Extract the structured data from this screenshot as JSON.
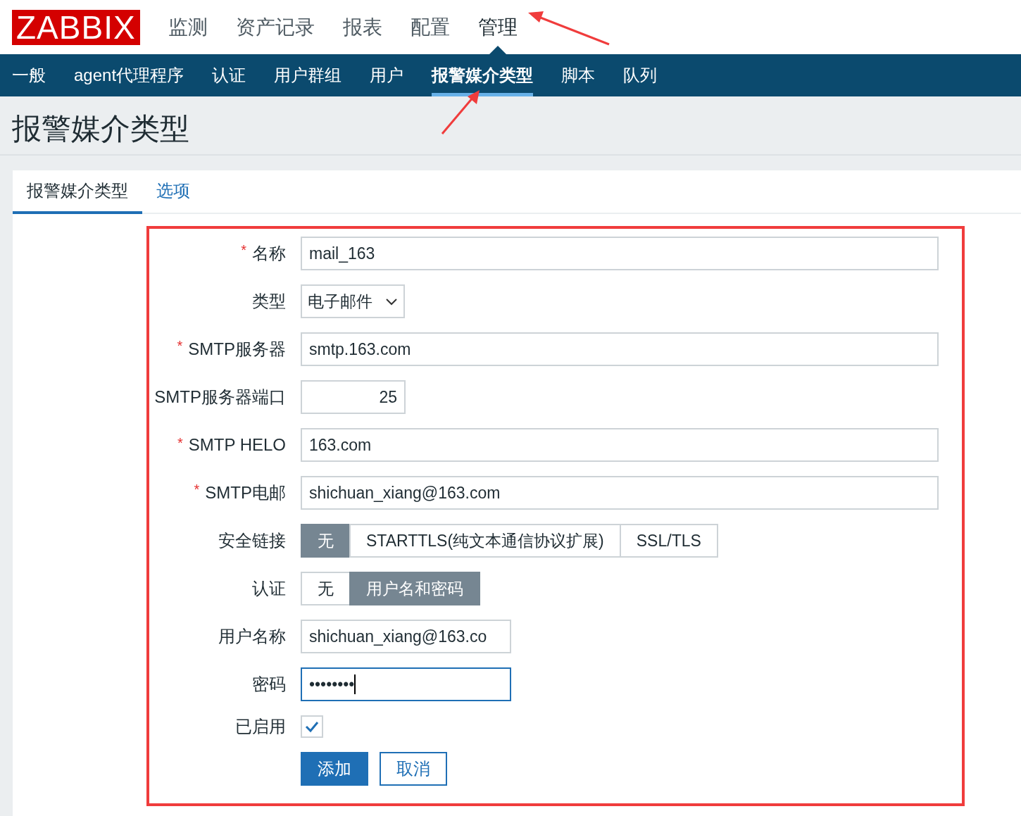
{
  "logo": "ZABBIX",
  "main_menu": [
    {
      "label": "监测",
      "selected": false
    },
    {
      "label": "资产记录",
      "selected": false
    },
    {
      "label": "报表",
      "selected": false
    },
    {
      "label": "配置",
      "selected": false
    },
    {
      "label": "管理",
      "selected": true
    }
  ],
  "sub_menu": [
    {
      "label": "一般",
      "selected": false
    },
    {
      "label": "agent代理程序",
      "selected": false
    },
    {
      "label": "认证",
      "selected": false
    },
    {
      "label": "用户群组",
      "selected": false
    },
    {
      "label": "用户",
      "selected": false
    },
    {
      "label": "报警媒介类型",
      "selected": true
    },
    {
      "label": "脚本",
      "selected": false
    },
    {
      "label": "队列",
      "selected": false
    }
  ],
  "page_title": "报警媒介类型",
  "tabs": [
    {
      "label": "报警媒介类型",
      "selected": true
    },
    {
      "label": "选项",
      "selected": false
    }
  ],
  "form": {
    "rows": [
      {
        "kind": "text",
        "label": "名称",
        "required_mark": "*",
        "value": "mail_163"
      },
      {
        "kind": "select",
        "label": "类型",
        "value": "电子邮件"
      },
      {
        "kind": "text",
        "label": "SMTP服务器",
        "required_mark": "*",
        "value": "smtp.163.com"
      },
      {
        "kind": "number",
        "label": "SMTP服务器端口",
        "value": "25"
      },
      {
        "kind": "text",
        "label": "SMTP HELO",
        "required_mark": "*",
        "value": "163.com"
      },
      {
        "kind": "text",
        "label": "SMTP电邮",
        "required_mark": "*",
        "value": "shichuan_xiang@163.com"
      },
      {
        "kind": "segmented",
        "label": "安全链接",
        "options": [
          {
            "label": "无",
            "selected": true
          },
          {
            "label": "STARTTLS(纯文本通信协议扩展)",
            "selected": false
          },
          {
            "label": "SSL/TLS",
            "selected": false
          }
        ]
      },
      {
        "kind": "segmented",
        "label": "认证",
        "options": [
          {
            "label": "无",
            "selected": false
          },
          {
            "label": "用户名和密码",
            "selected": true
          }
        ]
      },
      {
        "kind": "login",
        "label": "用户名称",
        "value": "shichuan_xiang@163.co"
      },
      {
        "kind": "password",
        "label": "密码",
        "value": "••••••••",
        "focused": true
      },
      {
        "kind": "checkbox",
        "label": "已启用",
        "checked": true
      }
    ],
    "buttons": [
      {
        "label": "添加",
        "kind": "primary"
      },
      {
        "label": "取消",
        "kind": "secondary"
      }
    ]
  }
}
